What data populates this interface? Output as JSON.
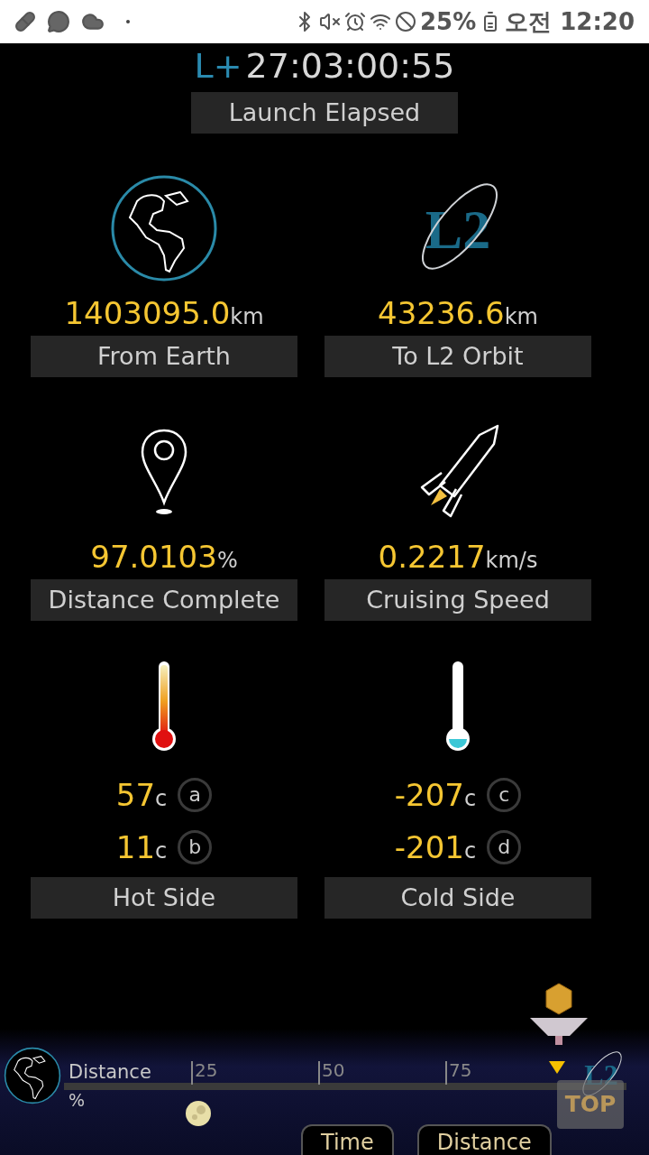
{
  "status_bar": {
    "battery": "25%",
    "time": "오전 12:20"
  },
  "timer": {
    "prefix": "L+",
    "value": "27:03:00:55",
    "label": "Launch Elapsed"
  },
  "orbit_logo": "L2",
  "stats": [
    {
      "kind": "earth",
      "value": "1403095.0",
      "unit": "km",
      "label": "From Earth"
    },
    {
      "kind": "l2",
      "value": "43236.6",
      "unit": "km",
      "label": "To L2 Orbit"
    },
    {
      "kind": "pin",
      "value": "97.0103",
      "unit": "%",
      "label": "Distance Complete"
    },
    {
      "kind": "rocket",
      "value": "0.2217",
      "unit": "km/s",
      "label": "Cruising Speed"
    }
  ],
  "temperatures": [
    {
      "kind": "hot",
      "label": "Hot Side",
      "readings": [
        {
          "value": "57",
          "unit": "c",
          "tag": "a"
        },
        {
          "value": "11",
          "unit": "c",
          "tag": "b"
        }
      ]
    },
    {
      "kind": "cold",
      "label": "Cold Side",
      "readings": [
        {
          "value": "-207",
          "unit": "c",
          "tag": "c"
        },
        {
          "value": "-201",
          "unit": "c",
          "tag": "d"
        }
      ]
    }
  ],
  "distance_track": {
    "label": "Distance",
    "unit": "%",
    "ticks": [
      "25",
      "50",
      "75"
    ],
    "end_logo": "L2"
  },
  "top_button": "TOP",
  "buttons": [
    "Time",
    "Distance"
  ]
}
